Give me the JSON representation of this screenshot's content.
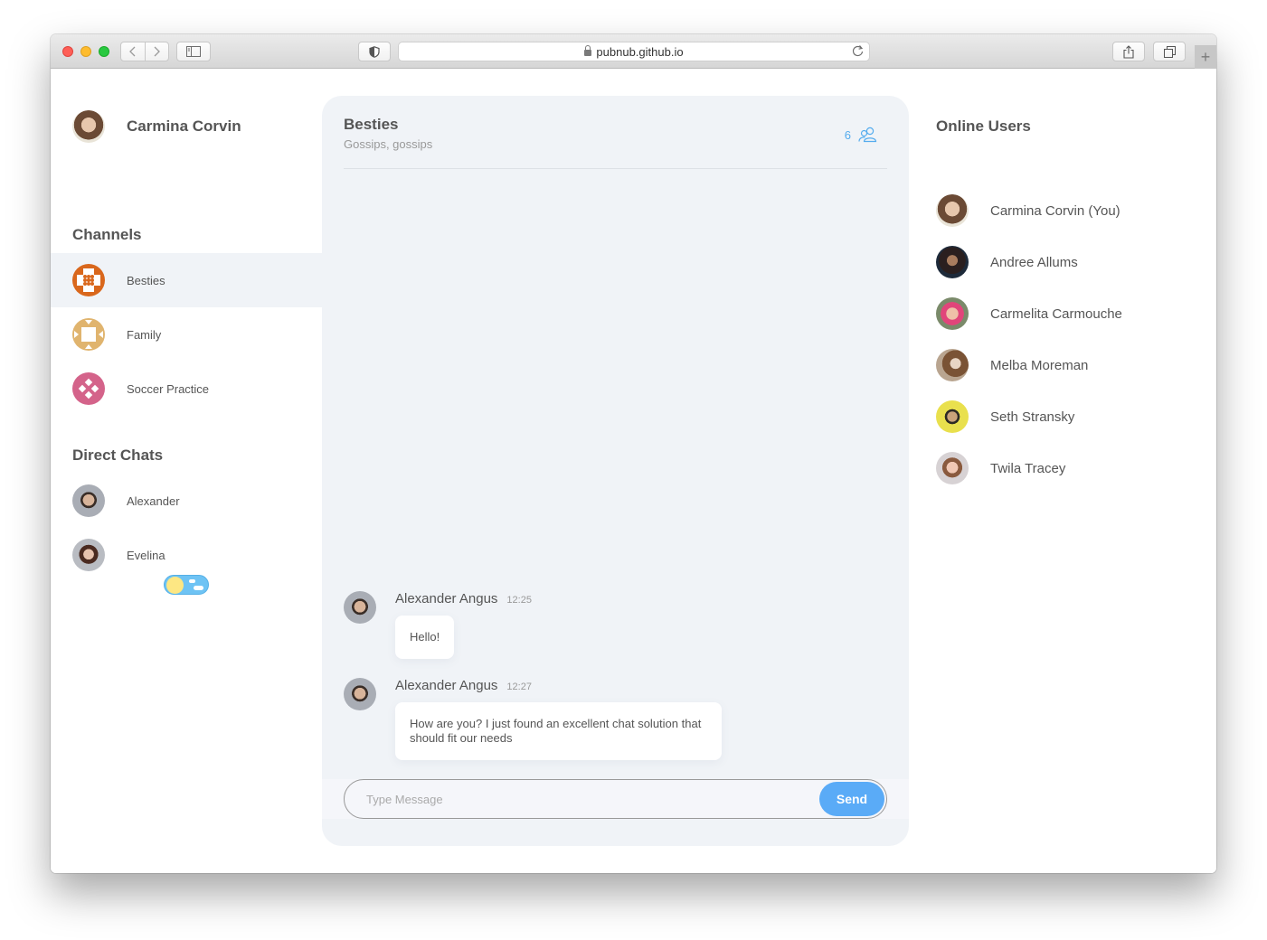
{
  "browser": {
    "url": "pubnub.github.io",
    "icons": {
      "back": "chevron-left-icon",
      "forward": "chevron-right-icon",
      "sidebar": "sidebar-icon",
      "privacy": "shield-icon",
      "reload": "reload-icon",
      "share": "share-icon",
      "tabs": "tabs-icon",
      "new_tab": "plus-icon"
    }
  },
  "profile": {
    "name": "Carmina Corvin"
  },
  "channels": {
    "title": "Channels",
    "items": [
      {
        "label": "Besties",
        "active": true,
        "color": "#d9671c"
      },
      {
        "label": "Family",
        "active": false,
        "color": "#e0b46e"
      },
      {
        "label": "Soccer Practice",
        "active": false,
        "color": "#d4638a"
      }
    ]
  },
  "direct_chats": {
    "title": "Direct Chats",
    "items": [
      {
        "label": "Alexander"
      },
      {
        "label": "Evelina"
      }
    ]
  },
  "theme_toggle": {
    "mode": "light"
  },
  "chat": {
    "title": "Besties",
    "description": "Gossips, gossips",
    "member_count": "6",
    "messages": [
      {
        "sender": "Alexander Angus",
        "time": "12:25",
        "text": "Hello!"
      },
      {
        "sender": "Alexander Angus",
        "time": "12:27",
        "text": "How are you? I just found an excellent chat solution that should fit our needs"
      }
    ],
    "composer": {
      "placeholder": "Type Message",
      "value": "",
      "send_label": "Send"
    }
  },
  "online_users": {
    "title": "Online Users",
    "items": [
      {
        "label": "Carmina Corvin (You)"
      },
      {
        "label": "Andree Allums"
      },
      {
        "label": "Carmelita Carmouche"
      },
      {
        "label": "Melba Moreman"
      },
      {
        "label": "Seth Stransky"
      },
      {
        "label": "Twila Tracey"
      }
    ]
  },
  "colors": {
    "accent": "#5aabf7",
    "panel_bg": "#f0f3f7",
    "text": "#555555"
  }
}
